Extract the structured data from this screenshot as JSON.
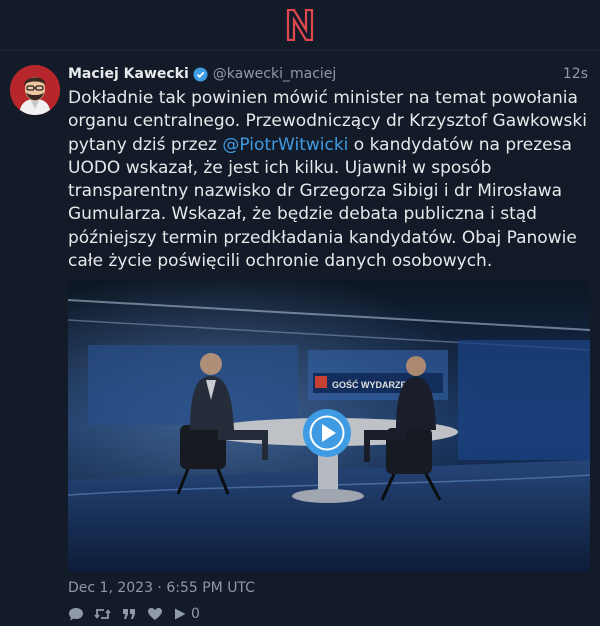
{
  "app": {
    "logo": "N"
  },
  "tweet": {
    "author_name": "Maciej Kawecki",
    "author_handle": "@kawecki_maciej",
    "time_ago": "12s",
    "text_part1": "Dokładnie tak powinien mówić minister na temat powołania organu centralnego. Przewodniczący dr Krzysztof Gawkowski pytany dziś przez ",
    "mention": "@PiotrWitwicki",
    "text_part2": " o kandydatów na prezesa UODO wskazał, że jest ich kilku. Ujawnił w sposób transparentny nazwisko dr Grzegorza Sibigi i dr Mirosława Gumularza. Wskazał, że będzie debata publiczna i stąd późniejszy termin przedkładania kandydatów. Obaj Panowie całe życie poświęcili ochronie danych osobowych.",
    "media_caption": "GOŚĆ WYDARZEŃ",
    "timestamp": "Dec 1, 2023 · 6:55 PM UTC",
    "play_count": "0"
  },
  "colors": {
    "background": "#121b27",
    "accent": "#3f9be3",
    "logo": "#e0484e",
    "muted": "#8f9aa6"
  },
  "icons": [
    "n-logo-icon",
    "verified-badge-icon",
    "play-icon",
    "reply-icon",
    "retweet-icon",
    "quote-icon",
    "like-icon",
    "views-icon"
  ]
}
